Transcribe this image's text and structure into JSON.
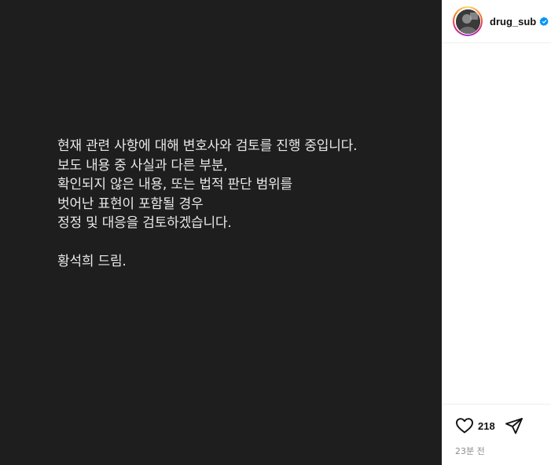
{
  "post": {
    "body_lines": [
      "현재 관련 사항에 대해 변호사와 검토를 진행 중입니다.",
      "보도 내용 중 사실과 다른 부분,",
      "확인되지 않은 내용, 또는 법적 판단 범위를",
      "벗어난 표현이 포함될 경우",
      "정정 및 대응을 검토하겠습니다."
    ],
    "signature": "황석희 드림."
  },
  "header": {
    "username": "drug_sub",
    "verified_icon": "verified-badge-icon"
  },
  "actions": {
    "like_icon": "heart-icon",
    "like_count": "218",
    "share_icon": "send-icon"
  },
  "meta": {
    "timestamp": "23분 전"
  },
  "colors": {
    "post_background": "#1e1e1e",
    "post_text": "#e8e8e8",
    "verified": "#0095f6",
    "muted": "#8e8e8e"
  }
}
